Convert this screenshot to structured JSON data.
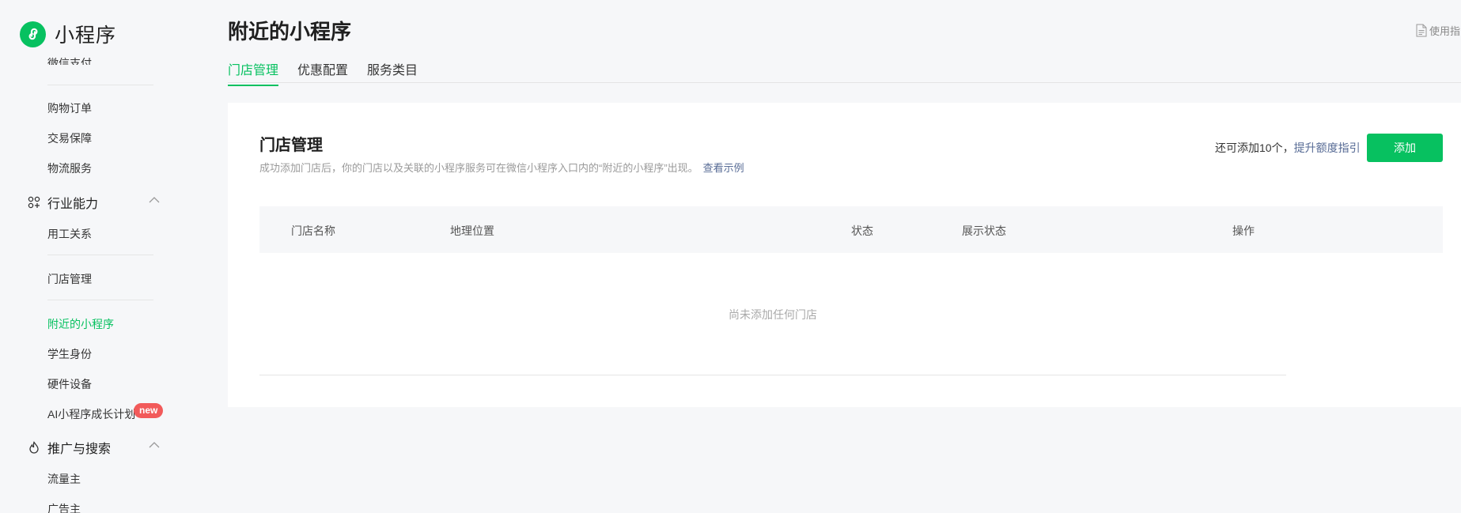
{
  "app": {
    "name": "小程序"
  },
  "sidebar": {
    "items": [
      {
        "label": "微信支付"
      },
      {
        "label": "购物订单"
      },
      {
        "label": "交易保障"
      },
      {
        "label": "物流服务"
      }
    ],
    "groups": [
      {
        "label": "行业能力",
        "icon": "industry-icon",
        "items": [
          {
            "label": "用工关系"
          },
          {
            "label": "门店管理"
          },
          {
            "label": "附近的小程序",
            "active": true
          },
          {
            "label": "学生身份"
          },
          {
            "label": "硬件设备"
          },
          {
            "label": "AI小程序成长计划",
            "badge": "new"
          }
        ]
      },
      {
        "label": "推广与搜索",
        "icon": "promotion-icon",
        "items": [
          {
            "label": "流量主"
          },
          {
            "label": "广告主"
          }
        ]
      }
    ]
  },
  "header": {
    "title": "附近的小程序",
    "help_label": "使用指",
    "tabs": [
      {
        "label": "门店管理",
        "active": true
      },
      {
        "label": "优惠配置"
      },
      {
        "label": "服务类目"
      }
    ]
  },
  "store_card": {
    "title": "门店管理",
    "description": "成功添加门店后，你的门店以及关联的小程序服务可在微信小程序入口内的“附近的小程序”出现。",
    "example_link": "查看示例",
    "quota_text": "还可添加10个，",
    "quota_link": "提升额度指引",
    "add_button": "添加",
    "columns": [
      "门店名称",
      "地理位置",
      "状态",
      "展示状态",
      "操作"
    ],
    "empty_text": "尚未添加任何门店"
  },
  "colors": {
    "accent": "#07c160",
    "link": "#576b95",
    "badge": "#f25a5a",
    "page_bg": "#f6f7f9"
  }
}
